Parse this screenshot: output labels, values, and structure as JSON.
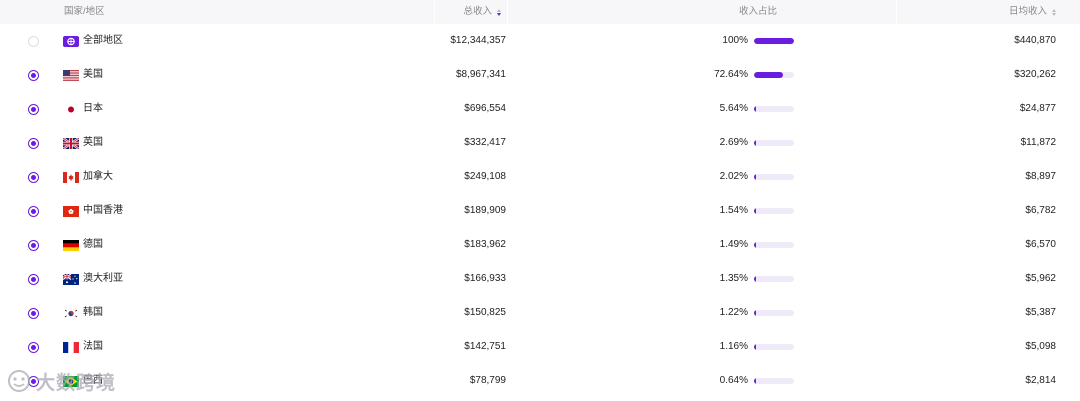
{
  "header": {
    "country": "国家/地区",
    "total": "总收入",
    "share": "收入占比",
    "daily": "日均收入"
  },
  "rows": [
    {
      "name": "全部地区",
      "total": "$12,344,357",
      "pct": "100%",
      "share": 100,
      "daily": "$440,870",
      "selected": false,
      "flag": "global"
    },
    {
      "name": "美国",
      "total": "$8,967,341",
      "pct": "72.64%",
      "share": 72.64,
      "daily": "$320,262",
      "selected": true,
      "flag": "us"
    },
    {
      "name": "日本",
      "total": "$696,554",
      "pct": "5.64%",
      "share": 5.64,
      "daily": "$24,877",
      "selected": true,
      "flag": "jp"
    },
    {
      "name": "英国",
      "total": "$332,417",
      "pct": "2.69%",
      "share": 2.69,
      "daily": "$11,872",
      "selected": true,
      "flag": "gb"
    },
    {
      "name": "加拿大",
      "total": "$249,108",
      "pct": "2.02%",
      "share": 2.02,
      "daily": "$8,897",
      "selected": true,
      "flag": "ca"
    },
    {
      "name": "中国香港",
      "total": "$189,909",
      "pct": "1.54%",
      "share": 1.54,
      "daily": "$6,782",
      "selected": true,
      "flag": "hk"
    },
    {
      "name": "德国",
      "total": "$183,962",
      "pct": "1.49%",
      "share": 1.49,
      "daily": "$6,570",
      "selected": true,
      "flag": "de"
    },
    {
      "name": "澳大利亚",
      "total": "$166,933",
      "pct": "1.35%",
      "share": 1.35,
      "daily": "$5,962",
      "selected": true,
      "flag": "au"
    },
    {
      "name": "韩国",
      "total": "$150,825",
      "pct": "1.22%",
      "share": 1.22,
      "daily": "$5,387",
      "selected": true,
      "flag": "kr"
    },
    {
      "name": "法国",
      "total": "$142,751",
      "pct": "1.16%",
      "share": 1.16,
      "daily": "$5,098",
      "selected": true,
      "flag": "fr"
    },
    {
      "name": "巴西",
      "total": "$78,799",
      "pct": "0.64%",
      "share": 0.64,
      "daily": "$2,814",
      "selected": true,
      "flag": "br"
    }
  ],
  "sort": {
    "active_column": "total",
    "direction": "desc"
  },
  "colors": {
    "accent": "#6a1de0",
    "bar_track": "#eeeaf7",
    "header_bg": "#f7f7f9"
  },
  "watermark": "大数跨境"
}
